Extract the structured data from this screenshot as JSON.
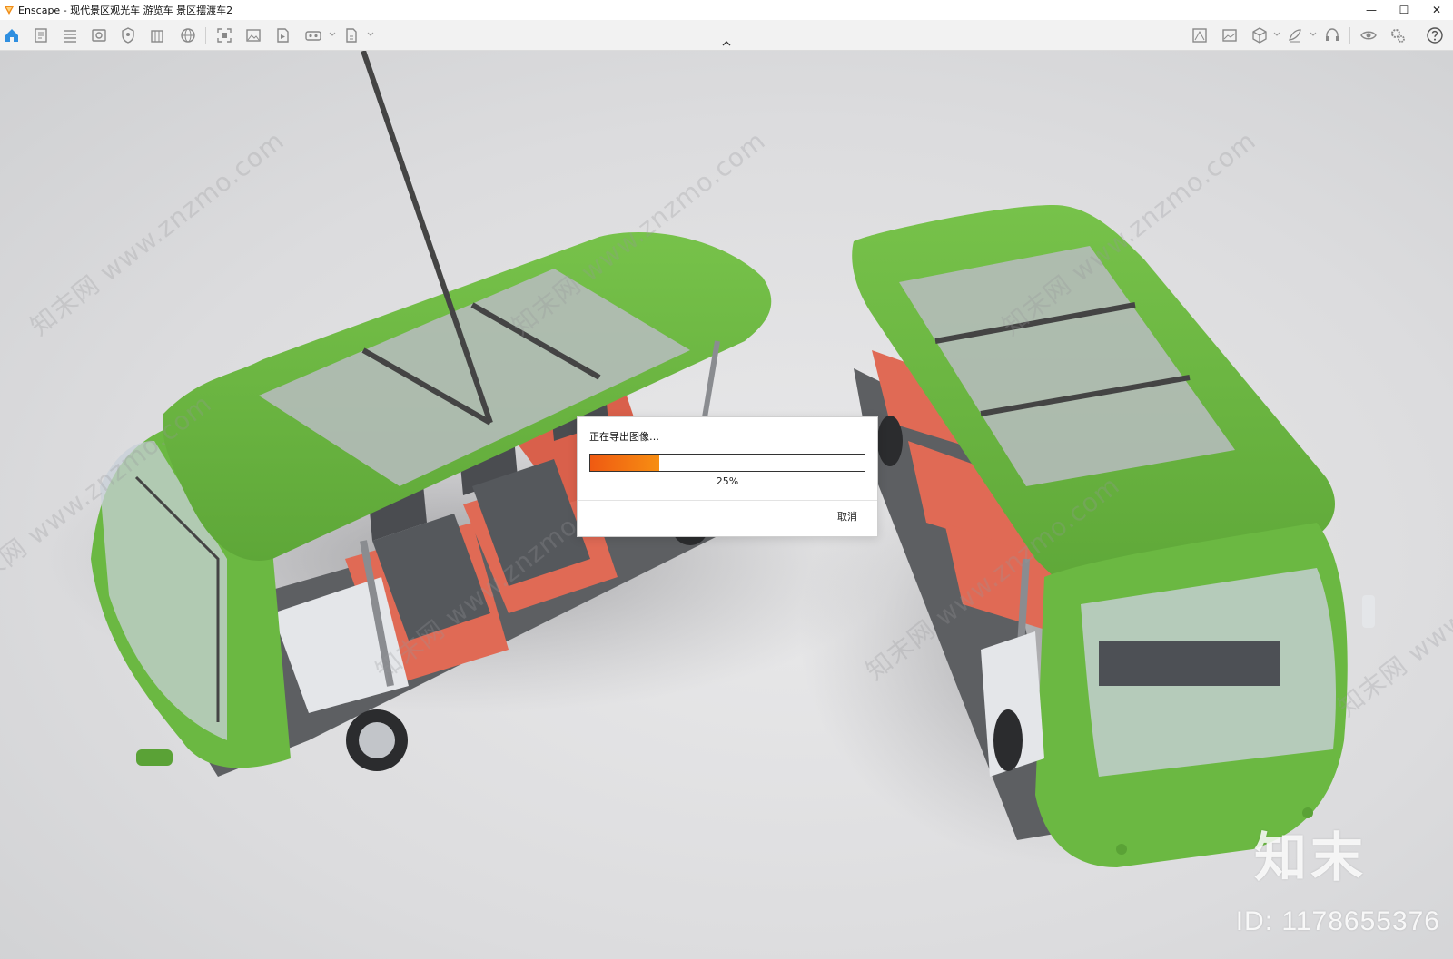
{
  "window": {
    "app_name": "Enscape",
    "title": "Enscape - 现代景区观光车 游览车 景区摆渡车2",
    "buttons": {
      "minimize": "—",
      "maximize": "☐",
      "close": "✕"
    }
  },
  "toolbar": {
    "left_icons": [
      "home-icon",
      "document-icon",
      "layers-icon",
      "view-icon",
      "settings-shield-icon",
      "building-icon",
      "globe-icon",
      "screenshot-icon",
      "image-icon",
      "video-icon",
      "vr-icon",
      "export-icon"
    ],
    "right_icons": [
      "asset-library-icon",
      "image-compare-icon",
      "cube-icon",
      "sketch-icon",
      "headset-icon",
      "eye-icon",
      "gears-icon",
      "help-icon"
    ]
  },
  "dialog": {
    "message": "正在导出图像…",
    "progress": 0.25,
    "progress_text": "25%",
    "cancel_label": "取消",
    "accent_color": "#f07818"
  },
  "watermark": {
    "text": "知末网 www.znzmo.com",
    "logo": "知末",
    "id_label": "ID: 1178655376"
  }
}
